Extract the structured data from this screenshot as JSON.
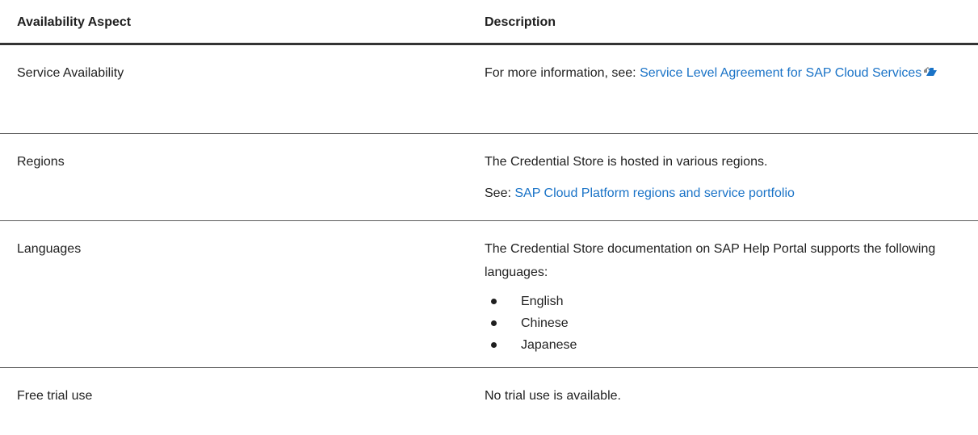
{
  "table": {
    "headers": {
      "aspect": "Availability Aspect",
      "description": "Description"
    },
    "rows": {
      "service": {
        "aspect": "Service Availability",
        "desc_prefix": "For more information, see: ",
        "desc_link": "Service Level Agreement for SAP Cloud Services",
        "link_icon": "external-link-icon"
      },
      "regions": {
        "aspect": "Regions",
        "desc_text": "The Credential Store is hosted in various regions.",
        "desc_prefix": "See: ",
        "desc_link": "SAP Cloud Platform regions and service portfolio"
      },
      "languages": {
        "aspect": "Languages",
        "desc_text": "The Credential Store documentation on SAP Help Portal supports the following languages:",
        "items": [
          "English",
          "Chinese",
          "Japanese"
        ]
      },
      "trial": {
        "aspect": "Free trial use",
        "desc_text": "No trial use is available."
      }
    }
  },
  "colors": {
    "link": "#1a73c7",
    "text": "#1f1f1f",
    "header_rule": "#333333",
    "row_rule": "#5a5a5a"
  }
}
